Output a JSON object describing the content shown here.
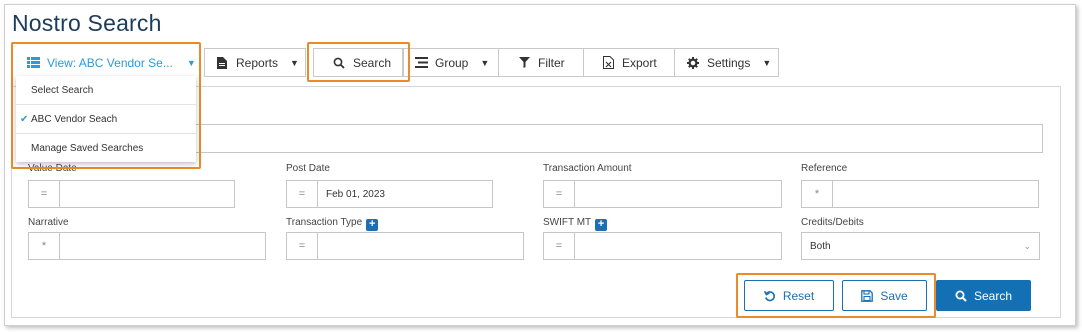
{
  "page": {
    "title": "Nostro Search"
  },
  "toolbar": {
    "view_label": "View: ABC Vendor Se...",
    "reports_label": "Reports",
    "search_label": "Search",
    "group_label": "Group",
    "filter_label": "Filter",
    "export_label": "Export",
    "settings_label": "Settings"
  },
  "view_menu": {
    "items": [
      {
        "label": "Select Search",
        "checked": false
      },
      {
        "label": "ABC Vendor Seach",
        "checked": true
      },
      {
        "label": "Manage Saved Searches",
        "checked": false
      }
    ]
  },
  "form": {
    "value_date": {
      "label": "Value Date",
      "operator": "=",
      "value": ""
    },
    "post_date": {
      "label": "Post Date",
      "operator": "=",
      "value": "Feb 01, 2023"
    },
    "transaction_amount": {
      "label": "Transaction Amount",
      "operator": "=",
      "value": ""
    },
    "reference": {
      "label": "Reference",
      "operator": "*",
      "value": ""
    },
    "narrative": {
      "label": "Narrative",
      "operator": "*",
      "value": ""
    },
    "transaction_type": {
      "label": "Transaction Type",
      "operator": "=",
      "value": ""
    },
    "swift_mt": {
      "label": "SWIFT MT",
      "operator": "=",
      "value": ""
    },
    "credits_debits": {
      "label": "Credits/Debits",
      "value": "Both"
    }
  },
  "actions": {
    "reset_label": "Reset",
    "save_label": "Save",
    "search_label": "Search"
  },
  "colors": {
    "title": "#1d3b5a",
    "accent_blue": "#1370b5",
    "highlight_orange": "#e98a2b",
    "teal": "#2a9bd6"
  }
}
